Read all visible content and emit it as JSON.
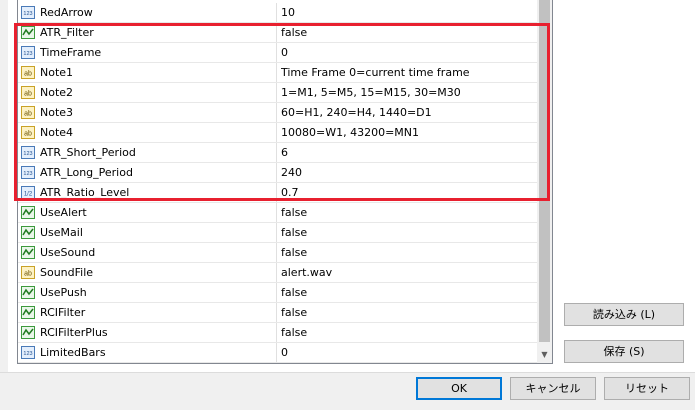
{
  "params": [
    {
      "icon": "number-icon",
      "name": "RedArrow",
      "value": "10"
    },
    {
      "icon": "bool-icon",
      "name": "ATR_Filter",
      "value": "false"
    },
    {
      "icon": "number-icon",
      "name": "TimeFrame",
      "value": "0"
    },
    {
      "icon": "text-icon",
      "name": "Note1",
      "value": "Time Frame 0=current time frame"
    },
    {
      "icon": "text-icon",
      "name": "Note2",
      "value": "1=M1, 5=M5, 15=M15, 30=M30"
    },
    {
      "icon": "text-icon",
      "name": "Note3",
      "value": "60=H1, 240=H4, 1440=D1"
    },
    {
      "icon": "text-icon",
      "name": "Note4",
      "value": "10080=W1, 43200=MN1"
    },
    {
      "icon": "number-icon",
      "name": "ATR_Short_Period",
      "value": "6"
    },
    {
      "icon": "number-icon",
      "name": "ATR_Long_Period",
      "value": "240"
    },
    {
      "icon": "fraction-icon",
      "name": "ATR_Ratio_Level",
      "value": "0.7"
    },
    {
      "icon": "bool-icon",
      "name": "UseAlert",
      "value": "false"
    },
    {
      "icon": "bool-icon",
      "name": "UseMail",
      "value": "false"
    },
    {
      "icon": "bool-icon",
      "name": "UseSound",
      "value": "false"
    },
    {
      "icon": "text-icon",
      "name": "SoundFile",
      "value": "alert.wav"
    },
    {
      "icon": "bool-icon",
      "name": "UsePush",
      "value": "false"
    },
    {
      "icon": "bool-icon",
      "name": "RCIFilter",
      "value": "false"
    },
    {
      "icon": "bool-icon",
      "name": "RCIFilterPlus",
      "value": "false"
    },
    {
      "icon": "number-icon",
      "name": "LimitedBars",
      "value": "0"
    }
  ],
  "side_buttons": {
    "load": "読み込み (L)",
    "save": "保存 (S)"
  },
  "dialog_buttons": {
    "ok": "OK",
    "cancel": "キャンセル",
    "reset": "リセット"
  },
  "icon_labels": {
    "number": "123",
    "text": "ab",
    "fraction": "1/2"
  },
  "colors": {
    "highlight": "#e8202f",
    "accent": "#0078d7"
  }
}
